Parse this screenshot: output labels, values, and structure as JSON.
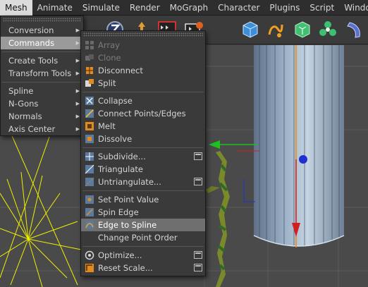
{
  "menubar": {
    "items": [
      "Mesh",
      "Animate",
      "Simulate",
      "Render",
      "MoGraph",
      "Character",
      "Plugins",
      "Script",
      "Window"
    ]
  },
  "toolbar": {
    "icons": [
      "timeline-icon",
      "render-view-icon",
      "render-picture-queue-icon",
      "render-settings-icon",
      "cube-primitive-icon",
      "spline-icon",
      "subdivision-surface-icon",
      "cloner-icon",
      "deformer-icon"
    ]
  },
  "mesh_menu": {
    "items": [
      {
        "label": "Conversion",
        "has_sub": true
      },
      {
        "label": "Commands",
        "has_sub": true,
        "active": true
      },
      {
        "sep": true
      },
      {
        "label": "Create Tools",
        "has_sub": true
      },
      {
        "label": "Transform Tools",
        "has_sub": true
      },
      {
        "sep": true
      },
      {
        "label": "Spline",
        "has_sub": true
      },
      {
        "label": "N-Gons",
        "has_sub": true
      },
      {
        "label": "Normals",
        "has_sub": true
      },
      {
        "label": "Axis Center",
        "has_sub": true
      }
    ]
  },
  "commands_menu": {
    "items": [
      {
        "label": "Array",
        "disabled": true
      },
      {
        "label": "Clone",
        "disabled": true
      },
      {
        "label": "Disconnect"
      },
      {
        "label": "Split"
      },
      {
        "sep": true
      },
      {
        "label": "Collapse"
      },
      {
        "label": "Connect Points/Edges"
      },
      {
        "label": "Melt"
      },
      {
        "label": "Dissolve"
      },
      {
        "sep": true
      },
      {
        "label": "Subdivide...",
        "options": true
      },
      {
        "label": "Triangulate"
      },
      {
        "label": "Untriangulate...",
        "options": true
      },
      {
        "sep": true
      },
      {
        "label": "Set Point Value"
      },
      {
        "label": "Spin Edge"
      },
      {
        "label": "Edge to Spline",
        "highlighted": true
      },
      {
        "label": "Change Point Order"
      },
      {
        "sep": true
      },
      {
        "label": "Optimize...",
        "options": true
      },
      {
        "label": "Reset Scale...",
        "options": true
      }
    ]
  },
  "colors": {
    "menu_bg": "#3a3a3a",
    "highlight": "#6f6f6f",
    "axis_x": "#d02020",
    "axis_y": "#20c020",
    "axis_z": "#2030d0",
    "spline": "#f0f000"
  }
}
